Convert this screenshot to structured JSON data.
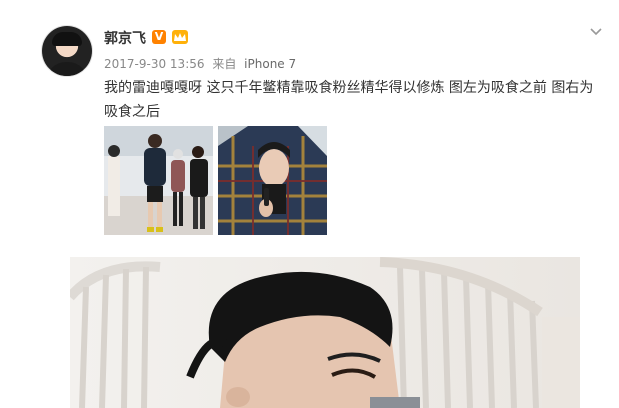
{
  "post": {
    "username": "郭京飞",
    "verified_badge": "V",
    "member_badge_icon": "vip-crown-icon",
    "timestamp": "2017-9-30 13:56",
    "source_prefix": "来自",
    "device": "iPhone 7",
    "text": "我的雷迪嘎嘎呀 这只千年鳖精靠吸食粉丝精华得以修炼 图左为吸食之前 图右为吸食之后",
    "menu_icon": "chevron-down-icon",
    "images": [
      {
        "name": "thumbnail-left",
        "description_icon": "photo-icon"
      },
      {
        "name": "thumbnail-right",
        "description_icon": "photo-icon"
      }
    ]
  },
  "colors": {
    "username": "#333333",
    "meta": "#888888",
    "text": "#333333",
    "v_badge": "#ff8200",
    "member_badge": "#ffb10a"
  }
}
